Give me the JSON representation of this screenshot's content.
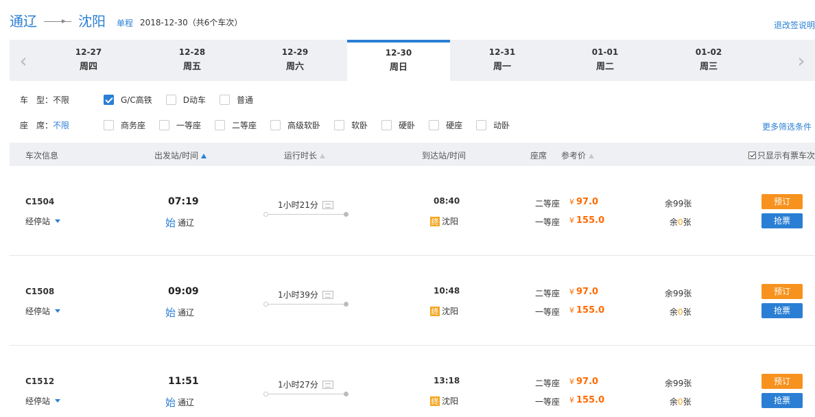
{
  "header": {
    "from": "通辽",
    "to": "沈阳",
    "trip_type": "单程",
    "trip_info": "2018-12-30（共6个车次）",
    "rules_link": "退改签说明"
  },
  "dates": [
    {
      "date": "12-27",
      "weekday": "周四"
    },
    {
      "date": "12-28",
      "weekday": "周五"
    },
    {
      "date": "12-29",
      "weekday": "周六"
    },
    {
      "date": "12-30",
      "weekday": "周日",
      "active": true
    },
    {
      "date": "12-31",
      "weekday": "周一"
    },
    {
      "date": "01-01",
      "weekday": "周二"
    },
    {
      "date": "01-02",
      "weekday": "周三"
    }
  ],
  "filters": {
    "type_label": "车　型：",
    "type_value": "不限",
    "type_options": [
      "G/C高铁",
      "D动车",
      "普通"
    ],
    "seat_label": "座　席：",
    "seat_value": "不限",
    "seat_options": [
      "商务座",
      "一等座",
      "二等座",
      "高级软卧",
      "软卧",
      "硬卧",
      "硬座",
      "动卧"
    ],
    "more": "更多筛选条件"
  },
  "table_header": {
    "train": "车次信息",
    "depart": "出发站/时间",
    "duration": "运行时长",
    "arrive": "到达站/时间",
    "seat": "座席",
    "price": "参考价",
    "only_available": "只显示有票车次"
  },
  "labels": {
    "stops": "经停站",
    "start_badge": "始",
    "end_badge": "终",
    "yen": "¥",
    "remain_prefix": "余",
    "remain_suffix": "张",
    "book": "预订",
    "grab": "抢票"
  },
  "trains": [
    {
      "no": "C1504",
      "dep_time": "07:19",
      "dep_station": "通辽",
      "duration": "1小时21分",
      "arr_time": "08:40",
      "arr_station": "沈阳",
      "seats": [
        {
          "name": "二等座",
          "price": "97.0",
          "remain": "99"
        },
        {
          "name": "一等座",
          "price": "155.0",
          "remain": "0"
        }
      ]
    },
    {
      "no": "C1508",
      "dep_time": "09:09",
      "dep_station": "通辽",
      "duration": "1小时39分",
      "arr_time": "10:48",
      "arr_station": "沈阳",
      "seats": [
        {
          "name": "二等座",
          "price": "97.0",
          "remain": "99"
        },
        {
          "name": "一等座",
          "price": "155.0",
          "remain": "0"
        }
      ]
    },
    {
      "no": "C1512",
      "dep_time": "11:51",
      "dep_station": "通辽",
      "duration": "1小时27分",
      "arr_time": "13:18",
      "arr_station": "沈阳",
      "seats": [
        {
          "name": "二等座",
          "price": "97.0",
          "remain": "99"
        },
        {
          "name": "一等座",
          "price": "155.0",
          "remain": "0"
        }
      ]
    }
  ],
  "colors": {
    "accent": "#2a7fd4",
    "price": "#ff6a00",
    "book": "#f7921e"
  }
}
